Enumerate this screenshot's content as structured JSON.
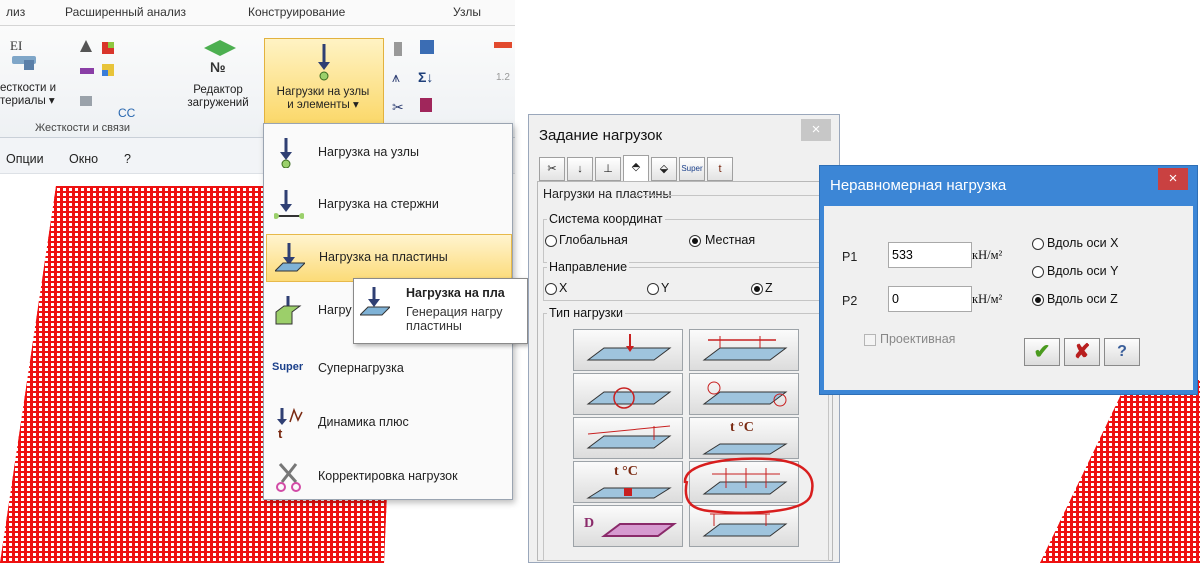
{
  "ribbon": {
    "tabs": [
      "лиз",
      "Расширенный анализ",
      "Конструирование",
      "Узлы"
    ],
    "btn_stiffness": "есткости и\nтериалы ▾",
    "btn_editor": "Редактор\nзагружений",
    "btn_loads": "Нагрузки на узлы\nи элементы ▾",
    "group_label": "Жесткости и связи",
    "tiny_cc": "CC"
  },
  "options_bar": {
    "options": "Опции",
    "window": "Окно",
    "help": "?"
  },
  "loads_menu": {
    "items": [
      {
        "label": "Нагрузка на узлы",
        "icon": "node-load-icon"
      },
      {
        "label": "Нагрузка на стержни",
        "icon": "bar-load-icon"
      },
      {
        "label": "Нагрузка на пластины",
        "icon": "plate-load-icon"
      },
      {
        "label": "Нагру",
        "icon": "volume-load-icon"
      },
      {
        "label": "Супернагрузка",
        "icon": "super-icon",
        "badge": "Super"
      },
      {
        "label": "Динамика плюс",
        "icon": "dynamics-icon"
      },
      {
        "label": "Корректировка нагрузок",
        "icon": "scissors-icon"
      }
    ]
  },
  "tooltip": {
    "title": "Нагрузка на пла",
    "text": "Генерация нагру\nпластины"
  },
  "load_dialog": {
    "title": "Задание нагрузок",
    "close": "×",
    "section_title": "Нагрузки на пластины",
    "coord_legend": "Система координат",
    "coord_global": "Глобальная",
    "coord_local": "Местная",
    "dir_legend": "Направление",
    "dir_x": "X",
    "dir_y": "Y",
    "dir_z": "Z",
    "type_legend": "Тип нагрузки",
    "super_tab": "Super",
    "temp_label": "t °C",
    "d_label": "D"
  },
  "nonuniform_dialog": {
    "title": "Неравномерная нагрузка",
    "close": "×",
    "p1_label": "P1",
    "p1_value": "533",
    "p2_label": "P2",
    "p2_value": "0",
    "unit": "кН/м²",
    "axis_x": "Вдоль оси X",
    "axis_y": "Вдоль оси Y",
    "axis_z": "Вдоль оси Z",
    "projective": "Проективная",
    "ok": "✔",
    "cancel": "✘",
    "help": "?"
  },
  "colors": {
    "mesh": "#ee1111",
    "titlebar": "#3c86d6",
    "highlight": "#fcdb78",
    "annotation": "#d81e1e"
  }
}
